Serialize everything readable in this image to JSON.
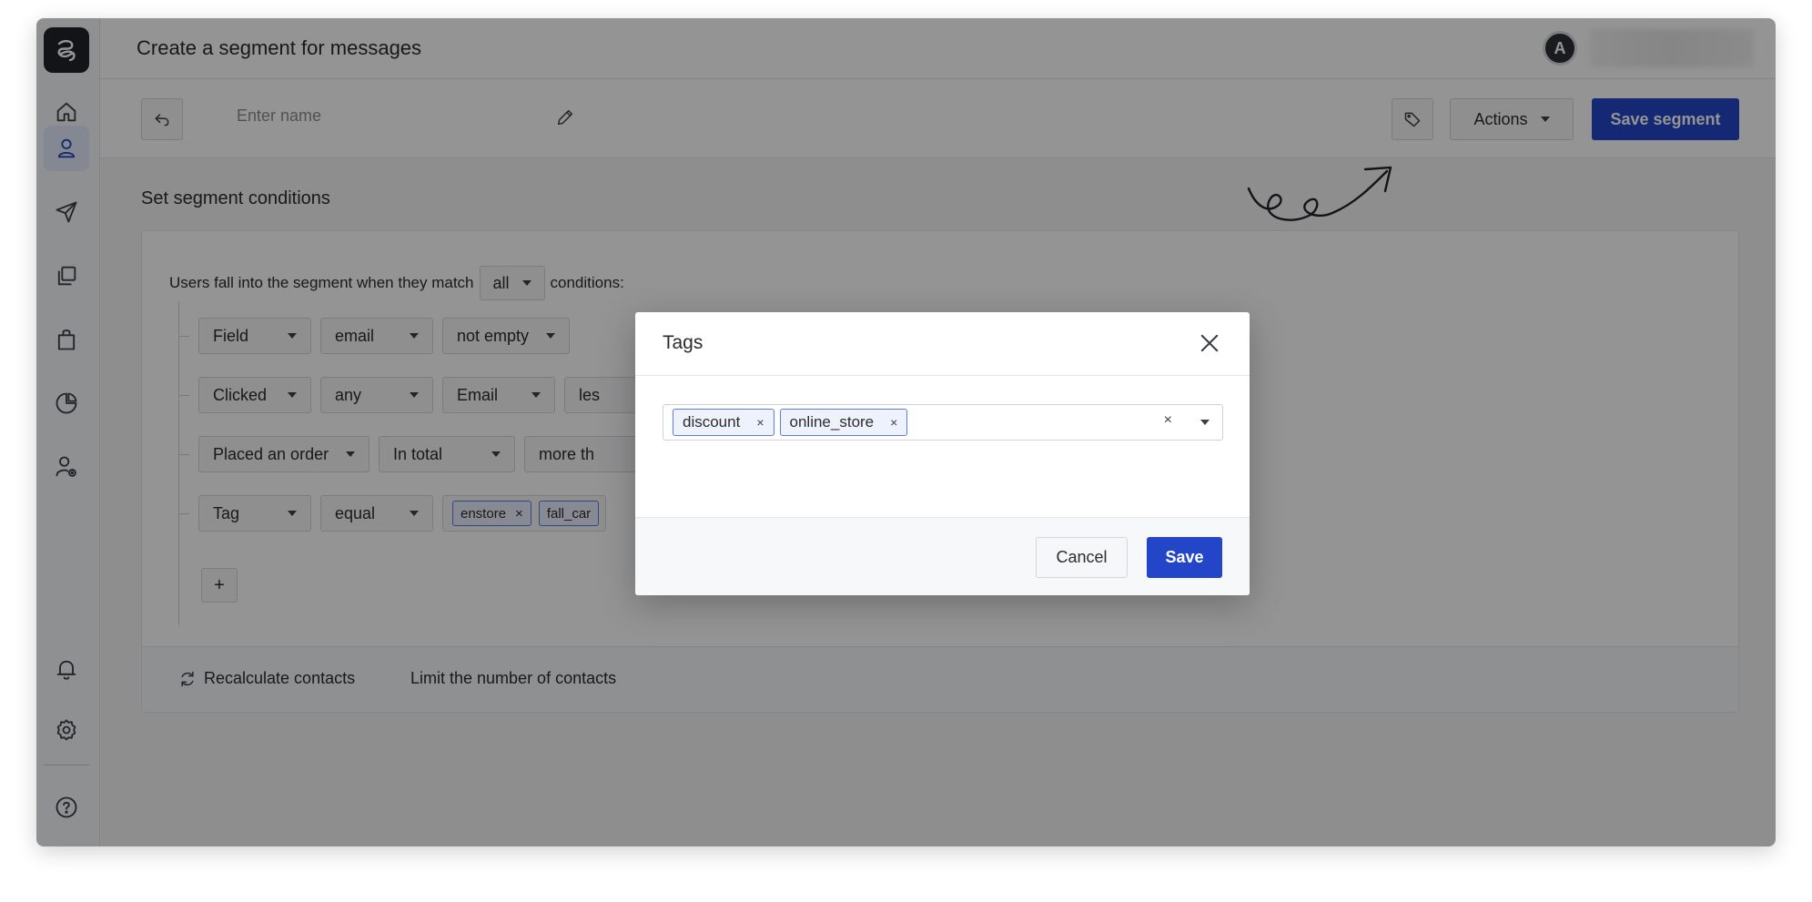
{
  "app": {
    "page_title": "Create a segment for messages",
    "avatar_letter": "A"
  },
  "sidebar": {
    "items": [
      {
        "icon": "home-icon"
      },
      {
        "icon": "user-icon",
        "active": true
      },
      {
        "icon": "send-icon"
      },
      {
        "icon": "copy-icon"
      },
      {
        "icon": "shopping-bag-icon"
      },
      {
        "icon": "pie-chart-icon"
      },
      {
        "icon": "user-settings-icon"
      }
    ],
    "bottom_items": [
      {
        "icon": "bell-icon"
      },
      {
        "icon": "gear-icon"
      },
      {
        "icon": "help-icon"
      }
    ]
  },
  "toolbar": {
    "name_placeholder": "Enter name",
    "actions_label": "Actions",
    "save_segment_label": "Save segment"
  },
  "conditions": {
    "section_title": "Set segment conditions",
    "match_prefix": "Users fall into the segment when they match",
    "match_value": "all",
    "match_suffix": "conditions:",
    "rows": [
      {
        "selects": [
          "Field",
          "email",
          "not empty"
        ]
      },
      {
        "selects": [
          "Clicked",
          "any",
          "Email",
          "les"
        ]
      },
      {
        "selects": [
          "Placed an order",
          "In total",
          "more th"
        ]
      },
      {
        "selects": [
          "Tag",
          "equal"
        ],
        "tags": [
          "enstore",
          "fall_car"
        ]
      }
    ],
    "add_label": "+",
    "recalculate_label": "Recalculate contacts",
    "limit_label": "Limit the number of contacts"
  },
  "modal": {
    "title": "Tags",
    "tags": [
      "discount",
      "online_store"
    ],
    "clear_symbol": "×",
    "cancel_label": "Cancel",
    "save_label": "Save"
  },
  "colors": {
    "accent": "#2346c9",
    "overlay": "rgba(0,0,0,0.42)"
  }
}
